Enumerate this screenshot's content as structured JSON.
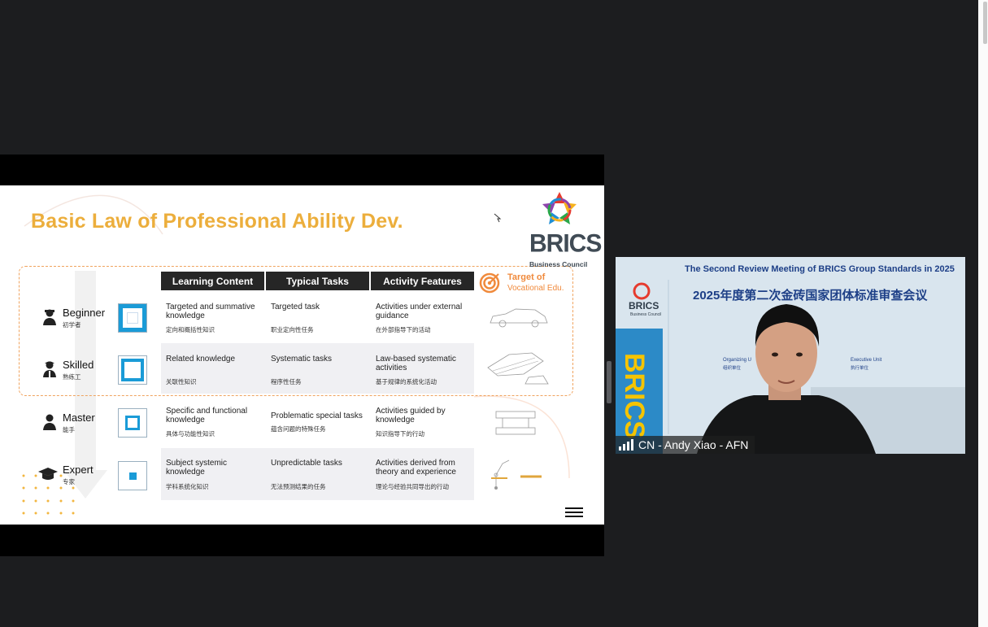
{
  "slide": {
    "title": "Basic Law of Professional Ability Dev.",
    "brics_logo": {
      "word": "BRICS",
      "subtitle": "Business Council"
    },
    "target_label": {
      "line1": "Target of",
      "line2": "Vocational Edu."
    },
    "columns": [
      "Learning Content",
      "Typical Tasks",
      "Activity Features"
    ],
    "rows": [
      {
        "level": "Beginner",
        "level_cn": "初学者",
        "icon": "worker-icon",
        "learning_en": "Targeted and summative knowledge",
        "learning_cn": "定向和概括性知识",
        "tasks_en": "Targeted task",
        "tasks_cn": "职业定向性任务",
        "features_en": "Activities under external guidance",
        "features_cn": "在外部指导下的活动",
        "illustration": "car-outline-icon"
      },
      {
        "level": "Skilled",
        "level_cn": "熟练工",
        "icon": "technician-icon",
        "learning_en": "Related knowledge",
        "learning_cn": "关联性知识",
        "tasks_en": "Systematic tasks",
        "tasks_cn": "程序性任务",
        "features_en": "Law-based systematic activities",
        "features_cn": "基于规律的系统化活动",
        "illustration": "car-assembly-icon"
      },
      {
        "level": "Master",
        "level_cn": "能手",
        "icon": "master-icon",
        "learning_en": "Specific and functional knowledge",
        "learning_cn": "具体与功能性知识",
        "tasks_en": "Problematic special tasks",
        "tasks_cn": "蕴含问题的特殊任务",
        "features_en": "Activities guided by knowledge",
        "features_cn": "知识指导下的行动",
        "illustration": "press-machine-icon"
      },
      {
        "level": "Expert",
        "level_cn": "专家",
        "icon": "graduation-cap-icon",
        "learning_en": "Subject systemic knowledge",
        "learning_cn": "学科系统化知识",
        "tasks_en": "Unpredictable tasks",
        "tasks_cn": "无法预测结果的任务",
        "features_en": "Activities derived from theory and experience",
        "features_cn": "理论与经验共同导出的行动",
        "illustration": "robot-arm-icon"
      }
    ],
    "colors": {
      "title": "#ecae3c",
      "header_bg": "#262626",
      "accent_blue": "#1a9bd7",
      "dashed": "#f0a35e"
    }
  },
  "video": {
    "banner_en": "The  Second  Review Meeting of BRICS Group Standards  in 2025",
    "banner_cn": "2025年度第二次金砖国家团体标准审查会议",
    "organizing_label_en": "Organizing U",
    "organizing_label_cn": "组织单位",
    "executive_label_en": "Executive Unit",
    "executive_label_cn": "执行单位",
    "participant_name": "CN - Andy Xiao - AFN",
    "signal_icon": "signal-bars-icon"
  }
}
